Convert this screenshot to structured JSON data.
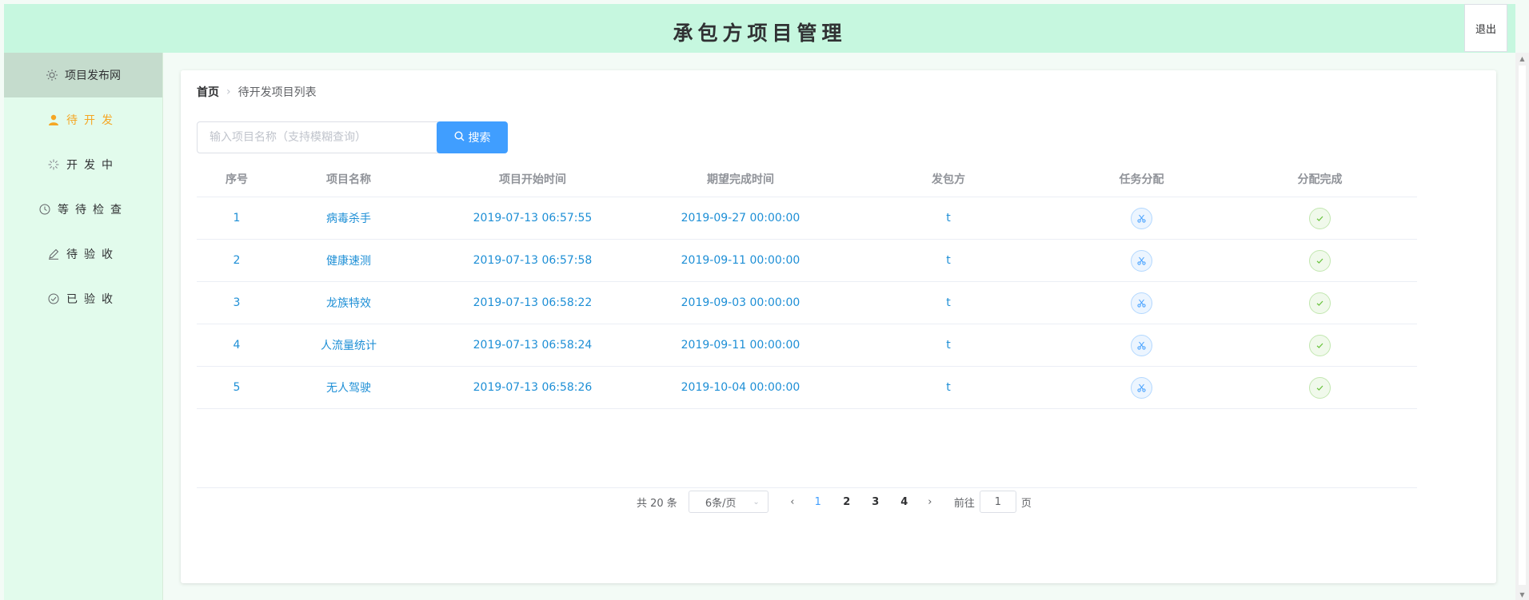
{
  "header": {
    "title": "承包方项目管理",
    "logout_label": "退出"
  },
  "sidebar": {
    "items": [
      {
        "label": "项目发布网",
        "icon": "sun-icon"
      },
      {
        "label": "待开发",
        "icon": "user-icon"
      },
      {
        "label": "开发中",
        "icon": "loading-icon"
      },
      {
        "label": "等待检查",
        "icon": "clock-icon"
      },
      {
        "label": "待验收",
        "icon": "edit-icon"
      },
      {
        "label": "已验收",
        "icon": "check-circle-icon"
      }
    ]
  },
  "breadcrumb": {
    "home": "首页",
    "current": "待开发项目列表"
  },
  "search": {
    "placeholder": "输入项目名称（支持模糊查询）",
    "button_label": "搜索"
  },
  "table": {
    "headers": [
      "序号",
      "项目名称",
      "项目开始时间",
      "期望完成时间",
      "发包方",
      "任务分配",
      "分配完成"
    ],
    "rows": [
      {
        "no": "1",
        "name": "病毒杀手",
        "start": "2019-07-13 06:57:55",
        "expected": "2019-09-27 00:00:00",
        "client": "t"
      },
      {
        "no": "2",
        "name": "健康速测",
        "start": "2019-07-13 06:57:58",
        "expected": "2019-09-11 00:00:00",
        "client": "t"
      },
      {
        "no": "3",
        "name": "龙族特效",
        "start": "2019-07-13 06:58:22",
        "expected": "2019-09-03 00:00:00",
        "client": "t"
      },
      {
        "no": "4",
        "name": "人流量统计",
        "start": "2019-07-13 06:58:24",
        "expected": "2019-09-11 00:00:00",
        "client": "t"
      },
      {
        "no": "5",
        "name": "无人驾驶",
        "start": "2019-07-13 06:58:26",
        "expected": "2019-10-04 00:00:00",
        "client": "t"
      }
    ]
  },
  "pagination": {
    "total": "共 20 条",
    "page_size": "6条/页",
    "pages": [
      "1",
      "2",
      "3",
      "4"
    ],
    "current": "1",
    "jump_prefix": "前往",
    "jump_value": "1",
    "jump_suffix": "页"
  },
  "colors": {
    "header_bg": "#c6f7df",
    "sidebar_bg": "#e2fbec",
    "primary": "#409eff",
    "link": "#1e8fd6",
    "active_menu": "#f5a623"
  }
}
